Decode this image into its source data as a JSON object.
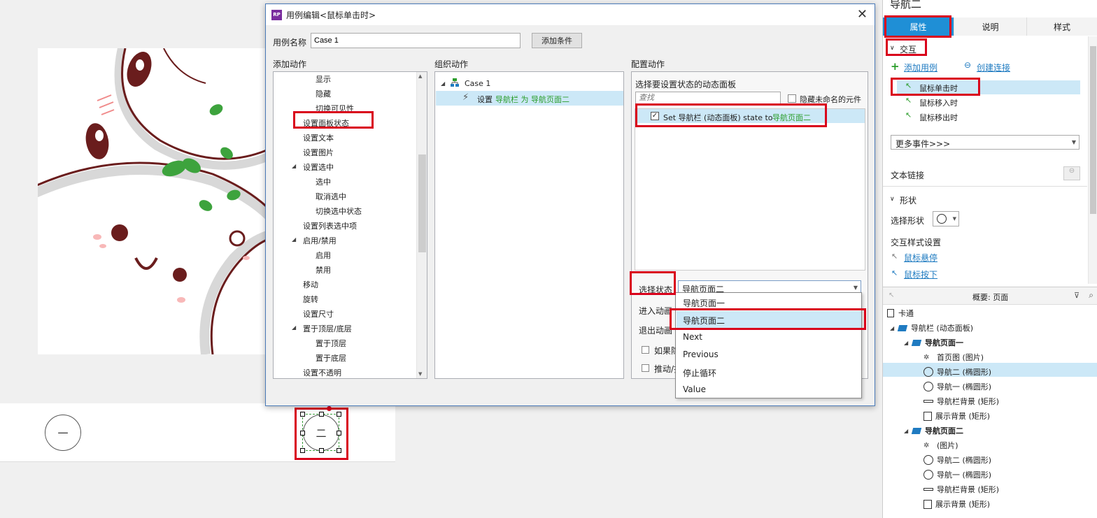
{
  "canvas": {
    "btn_one": "一",
    "btn_two": "二"
  },
  "dialog": {
    "title": "用例编辑<鼠标单击时>",
    "close": "✕",
    "case_name_label": "用例名称",
    "case_name_value": "Case 1",
    "add_condition": "添加条件",
    "add_action_header": "添加动作",
    "organize_header": "组织动作",
    "configure_header": "配置动作",
    "actions": [
      {
        "label": "显示",
        "indent": 2
      },
      {
        "label": "隐藏",
        "indent": 2
      },
      {
        "label": "切换可见性",
        "indent": 2
      },
      {
        "label": "设置面板状态",
        "indent": 1
      },
      {
        "label": "设置文本",
        "indent": 1
      },
      {
        "label": "设置图片",
        "indent": 1
      },
      {
        "label": "设置选中",
        "indent": 1,
        "expand": true
      },
      {
        "label": "选中",
        "indent": 2
      },
      {
        "label": "取消选中",
        "indent": 2
      },
      {
        "label": "切换选中状态",
        "indent": 2
      },
      {
        "label": "设置列表选中项",
        "indent": 1
      },
      {
        "label": "启用/禁用",
        "indent": 1,
        "expand": true
      },
      {
        "label": "启用",
        "indent": 2
      },
      {
        "label": "禁用",
        "indent": 2
      },
      {
        "label": "移动",
        "indent": 1
      },
      {
        "label": "旋转",
        "indent": 1
      },
      {
        "label": "设置尺寸",
        "indent": 1
      },
      {
        "label": "置于顶层/底层",
        "indent": 1,
        "expand": true
      },
      {
        "label": "置于顶层",
        "indent": 2
      },
      {
        "label": "置于底层",
        "indent": 2
      },
      {
        "label": "设置不透明",
        "indent": 1
      }
    ],
    "organize": {
      "case_label": "Case 1",
      "action_prefix": "设置 ",
      "action_target": "导航栏 为 导航页面二"
    },
    "configure": {
      "select_panel_label": "选择要设置状态的动态面板",
      "search_placeholder": "查找",
      "hide_unnamed": "隐藏未命名的元件",
      "panel_item_prefix": "Set 导航栏 (动态面板) state to ",
      "panel_item_state": "导航页面二",
      "select_state_label": "选择状态",
      "select_state_value": "导航页面二",
      "enter_anim": "进入动画",
      "exit_anim": "退出动画",
      "if_hidden": "如果隐",
      "push": "推动/拉"
    },
    "dropdown_options": [
      "导航页面一",
      "导航页面二",
      "Next",
      "Previous",
      "停止循环",
      "Value"
    ]
  },
  "right_panel": {
    "title": "导航二",
    "tabs": [
      "属性",
      "说明",
      "样式"
    ],
    "interaction_header": "交互",
    "add_case": "添加用例",
    "create_link": "创建连接",
    "events": [
      "鼠标单击时",
      "鼠标移入时",
      "鼠标移出时"
    ],
    "more_events": "更多事件>>>",
    "text_link": "文本链接",
    "shape_header": "形状",
    "select_shape": "选择形状",
    "interaction_style": "交互样式设置",
    "hover": "鼠标悬停",
    "pressed": "鼠标按下",
    "outline_title": "概要: 页面",
    "outline": [
      {
        "label": "卡通",
        "icon": "page",
        "level": 0
      },
      {
        "label": "导航栏 (动态面板)",
        "icon": "dynamic-panel",
        "level": 0
      },
      {
        "label": "导航页面一",
        "icon": "state",
        "level": 1
      },
      {
        "label": "首页图 (图片)",
        "icon": "image",
        "level": 2
      },
      {
        "label": "导航二 (椭圆形)",
        "icon": "ellipse",
        "level": 2
      },
      {
        "label": "导航一 (椭圆形)",
        "icon": "ellipse",
        "level": 2
      },
      {
        "label": "导航栏背景 (矩形)",
        "icon": "line",
        "level": 2
      },
      {
        "label": "展示背景 (矩形)",
        "icon": "rect",
        "level": 2
      },
      {
        "label": "导航页面二",
        "icon": "state",
        "level": 1
      },
      {
        "label": "(图片)",
        "icon": "image",
        "level": 2
      },
      {
        "label": "导航二 (椭圆形)",
        "icon": "ellipse",
        "level": 2
      },
      {
        "label": "导航一 (椭圆形)",
        "icon": "ellipse",
        "level": 2
      },
      {
        "label": "导航栏背景 (矩形)",
        "icon": "line",
        "level": 2
      },
      {
        "label": "展示背景 (矩形)",
        "icon": "rect",
        "level": 2
      }
    ]
  }
}
